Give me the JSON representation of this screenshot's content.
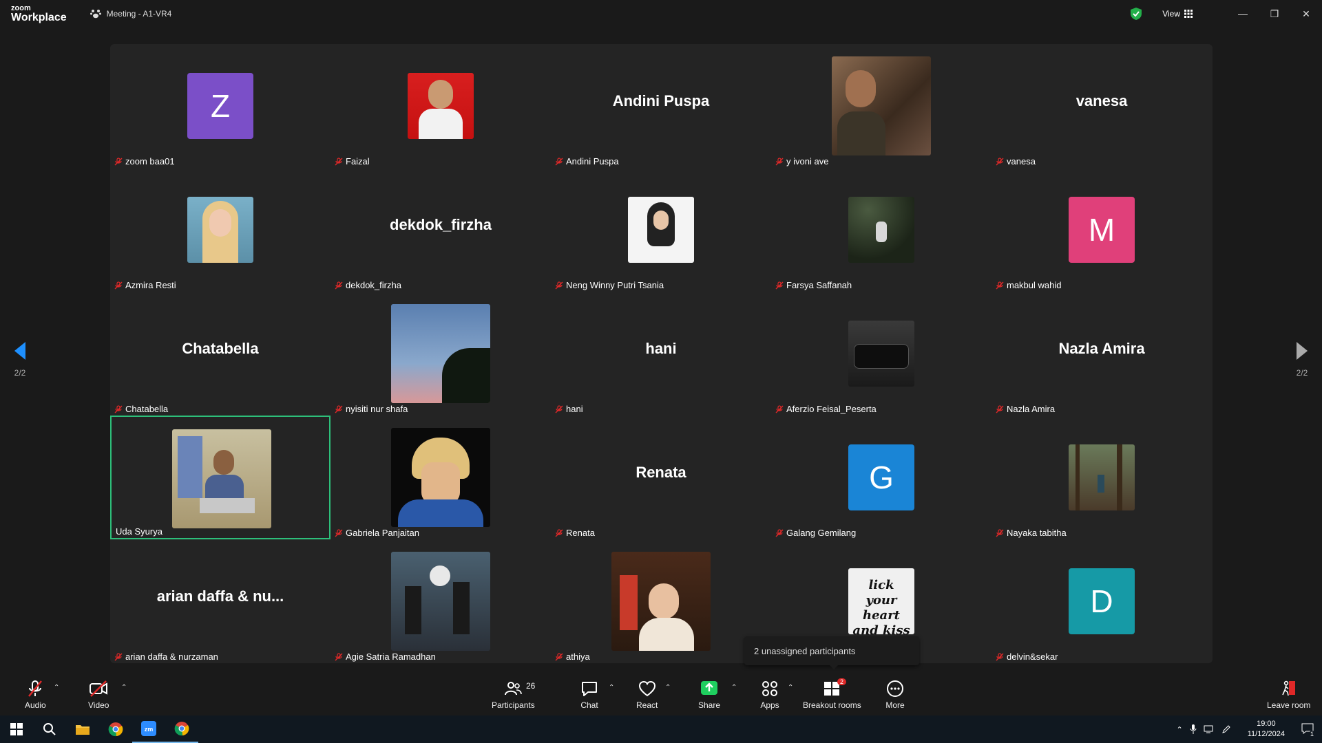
{
  "titlebar": {
    "brand_top": "zoom",
    "brand_main": "Workplace",
    "meeting_title": "Meeting - A1-VR4",
    "view_label": "View"
  },
  "pagination": {
    "left": "2/2",
    "right": "2/2"
  },
  "participants": [
    {
      "label": "zoom baa01",
      "display": "letter",
      "letter": "Z",
      "color": "#7b4fc8"
    },
    {
      "label": "Faizal",
      "display": "photo",
      "photo": "portrait-red-bg"
    },
    {
      "label": "Andini Puspa",
      "display": "name",
      "center": "Andini Puspa"
    },
    {
      "label": "y ivoni ave",
      "display": "photo",
      "photo": "cafe-selfie"
    },
    {
      "label": "vanesa",
      "display": "name",
      "center": "vanesa"
    },
    {
      "label": "Azmira Resti",
      "display": "photo",
      "photo": "blonde-portrait"
    },
    {
      "label": "dekdok_firzha",
      "display": "name",
      "center": "dekdok_firzha"
    },
    {
      "label": "Neng Winny Putri Tsania",
      "display": "photo",
      "photo": "hijab-portrait"
    },
    {
      "label": "Farsya Saffanah",
      "display": "photo",
      "photo": "night-field"
    },
    {
      "label": "makbul wahid",
      "display": "letter",
      "letter": "M",
      "color": "#e0407a"
    },
    {
      "label": "Chatabella",
      "display": "name",
      "center": "Chatabella"
    },
    {
      "label": "nyisiti nur shafa",
      "display": "photo",
      "photo": "evening-sky"
    },
    {
      "label": "hani",
      "display": "name",
      "center": "hani"
    },
    {
      "label": "Aferzio Feisal_Peserta",
      "display": "photo",
      "photo": "black-car"
    },
    {
      "label": "Nazla Amira",
      "display": "name",
      "center": "Nazla Amira"
    },
    {
      "label": "Uda Syurya",
      "display": "photo",
      "photo": "office-video",
      "active": true
    },
    {
      "label": "Gabriela Panjaitan",
      "display": "photo",
      "photo": "anime-art"
    },
    {
      "label": "Renata",
      "display": "name",
      "center": "Renata"
    },
    {
      "label": "Galang Gemilang",
      "display": "letter",
      "letter": "G",
      "color": "#1a85d6"
    },
    {
      "label": "Nayaka tabitha",
      "display": "photo",
      "photo": "forest"
    },
    {
      "label": "arian daffa & nurzaman",
      "display": "name",
      "center": "arian daffa & nu..."
    },
    {
      "label": "Agie Satria Ramadhan",
      "display": "photo",
      "photo": "band-stage"
    },
    {
      "label": "athiya",
      "display": "photo",
      "photo": "restaurant-portrait"
    },
    {
      "label": "",
      "display": "photo",
      "photo": "shirt-text"
    },
    {
      "label": "delvin&sekar",
      "display": "letter",
      "letter": "D",
      "color": "#169aa6"
    }
  ],
  "tooltip": "2 unassigned participants",
  "toolbar": {
    "audio": "Audio",
    "video": "Video",
    "participants": "Participants",
    "participants_count": "26",
    "chat": "Chat",
    "react": "React",
    "share": "Share",
    "apps": "Apps",
    "breakout": "Breakout rooms",
    "breakout_badge": "2",
    "more": "More",
    "leave": "Leave room"
  },
  "taskbar": {
    "time": "19:00",
    "date": "11/12/2024",
    "notifications": "1"
  },
  "colors": {
    "active_border": "#2dbf7a",
    "share_green": "#1fcf5f",
    "muted_red": "#e02828"
  }
}
